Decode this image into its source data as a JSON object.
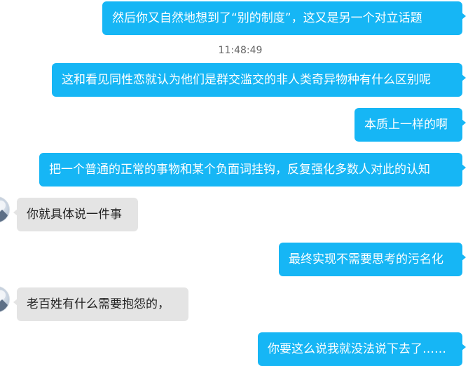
{
  "messages": [
    {
      "side": "out",
      "text": "然后你又自然地想到了“别的制度”，这又是另一个对立话题"
    },
    {
      "side": "time",
      "text": "11:48:49"
    },
    {
      "side": "out",
      "text": "这和看见同性恋就认为他们是群交滥交的非人类奇异物种有什么区别呢"
    },
    {
      "side": "out",
      "text": "本质上一样的啊"
    },
    {
      "side": "out",
      "text": "把一个普通的正常的事物和某个负面词挂钩，反复强化多数人对此的认知"
    },
    {
      "side": "in",
      "text": "你就具体说一件事"
    },
    {
      "side": "out",
      "text": "最终实现不需要思考的污名化"
    },
    {
      "side": "in",
      "text": "老百姓有什么需要抱怨的，"
    },
    {
      "side": "out",
      "text": "你要这么说我就没法说下去了……"
    }
  ],
  "colors": {
    "outgoing_bubble": "#16b6f5",
    "incoming_bubble": "#e4e4e4",
    "timestamp_text": "#666666"
  }
}
